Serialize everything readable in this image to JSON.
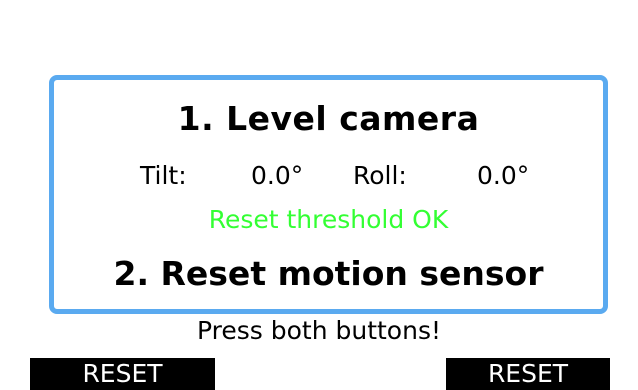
{
  "colors": {
    "panel_border": "#5aaaf0",
    "status_ok": "#33ff33",
    "softkey_bg": "#000000",
    "softkey_text": "#ffffff"
  },
  "panel": {
    "step1_title": "1. Level camera",
    "tilt_label": "Tilt:",
    "tilt_value": "0.0°",
    "roll_label": "Roll:",
    "roll_value": "0.0°",
    "status": "Reset threshold OK",
    "step2_title": "2. Reset motion sensor"
  },
  "prompt": "Press both buttons!",
  "softkeys": {
    "left_label": "RESET",
    "right_label": "RESET"
  }
}
